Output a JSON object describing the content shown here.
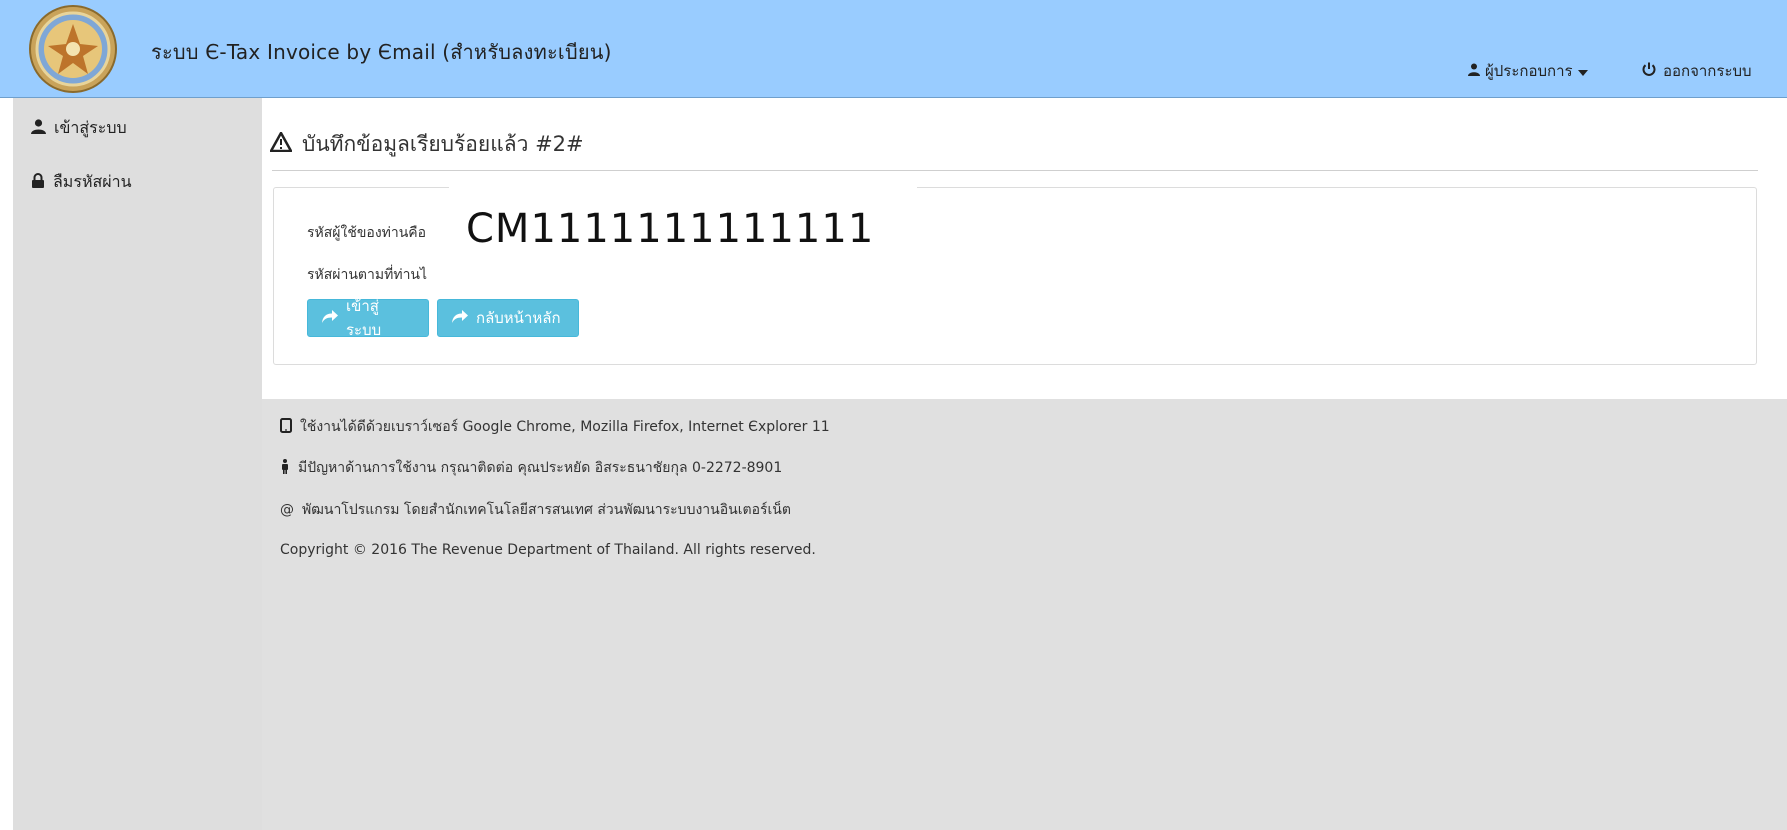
{
  "header": {
    "app_title": "ระบบ Є-Tax Invoice by Єmail (สำหรับลงทะเบียน)",
    "user_menu_label": "ผู้ประกอบการ",
    "logout_label": "ออกจากระบบ"
  },
  "sidebar": {
    "items": [
      {
        "label": "เข้าสู่ระบบ",
        "icon": "user-icon"
      },
      {
        "label": "ลืมรหัสผ่าน",
        "icon": "lock-icon"
      }
    ]
  },
  "main": {
    "heading": "บันทึกข้อมูลเรียบร้อยแล้ว #2#",
    "user_id_label": "รหัสผู้ใช้ของท่านคือ",
    "user_id_value": "CM1111111111111",
    "password_label": "รหัสผ่านตามที่ท่านไ",
    "buttons": {
      "login": "เข้าสู่ระบบ",
      "home": "กลับหน้าหลัก"
    }
  },
  "footer": {
    "browser_note": "ใช้งานได้ดีด้วยเบราว์เซอร์ Google Chrome, Mozilla Firefox, Internet Єxplorer 11",
    "support_note": "มีปัญหาด้านการใช้งาน กรุณาติดต่อ คุณประหยัด อิสระธนาชัยกุล 0-2272-8901",
    "developer_note": "พัฒนาโปรแกรม โดยสำนักเทคโนโลยีสารสนเทศ ส่วนพัฒนาระบบงานอินเตอร์เน็ต",
    "copyright": "Copyright © 2016 The Revenue Department of Thailand. All rights reserved."
  },
  "colors": {
    "header_bg": "#99ccff",
    "sidebar_bg": "#dedede",
    "footer_bg": "#e0e0e0",
    "button_bg": "#5bc0de"
  }
}
